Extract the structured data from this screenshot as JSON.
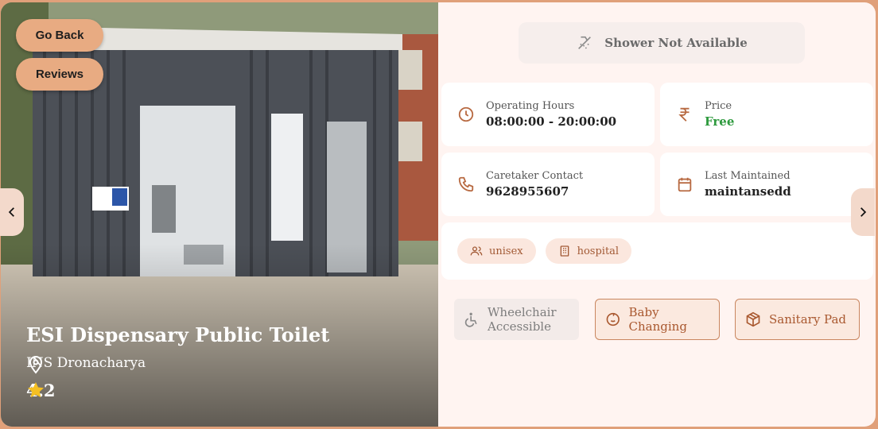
{
  "buttons": {
    "go_back": "Go Back",
    "reviews": "Reviews"
  },
  "place": {
    "name": "ESI Dispensary Public Toilet",
    "location": "INS Dronacharya",
    "rating": "4.2"
  },
  "shower": {
    "label": "Shower Not Available",
    "icon": "shower-off-icon"
  },
  "info": {
    "hours_label": "Operating Hours",
    "hours_value": "08:00:00 - 20:00:00",
    "price_label": "Price",
    "price_value": "Free",
    "contact_label": "Caretaker Contact",
    "contact_value": "9628955607",
    "maint_label": "Last Maintained",
    "maint_value": "maintansedd"
  },
  "tags": [
    "unisex",
    "hospital"
  ],
  "amenities": {
    "wheelchair_line1": "Wheelchair",
    "wheelchair_line2": "Accessible",
    "baby": "Baby Changing",
    "pad": "Sanitary Pad"
  },
  "colors": {
    "accent": "#e8ab82",
    "price_green": "#2e9a3e",
    "tag_text": "#a25a35"
  }
}
